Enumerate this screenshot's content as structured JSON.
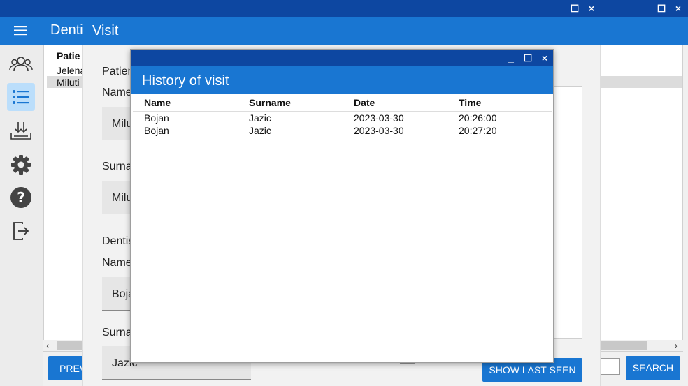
{
  "app": {
    "title": "Denti",
    "window_controls": [
      "_",
      "☐",
      "×"
    ],
    "nav_items": [
      {
        "icon": "patients-icon",
        "active": false
      },
      {
        "icon": "list-icon",
        "active": true
      },
      {
        "icon": "download-icon",
        "active": false
      },
      {
        "icon": "gear-icon",
        "active": false
      },
      {
        "icon": "help-icon",
        "active": false
      },
      {
        "icon": "logout-icon",
        "active": false
      }
    ],
    "accent": "#1976d2",
    "titlebar_color": "#0d47a1"
  },
  "background_table": {
    "header": "Patie",
    "rows": [
      "Jelena",
      "Miluti"
    ],
    "prev_button": "PREV",
    "search_button": "SEARCH"
  },
  "visit": {
    "title": "Visit",
    "patient_section": "Patien",
    "name_label": "Name",
    "name_value": "Milu",
    "surname_label": "Surna",
    "surname_value": "Milu",
    "dentist_section": "Dentis",
    "dentist_name_label": "Name",
    "dentist_name_value": "Boja",
    "dentist_surname_label": "Surna",
    "dentist_surname_value": "Jazic",
    "show_last_seen_button": "SHOW LAST SEEN"
  },
  "history": {
    "title": "History of visit",
    "columns": [
      "Name",
      "Surname",
      "Date",
      "Time"
    ],
    "rows": [
      [
        "Bojan",
        "Jazic",
        "2023-03-30",
        "20:26:00"
      ],
      [
        "Bojan",
        "Jazic",
        "2023-03-30",
        "20:27:20"
      ]
    ]
  }
}
